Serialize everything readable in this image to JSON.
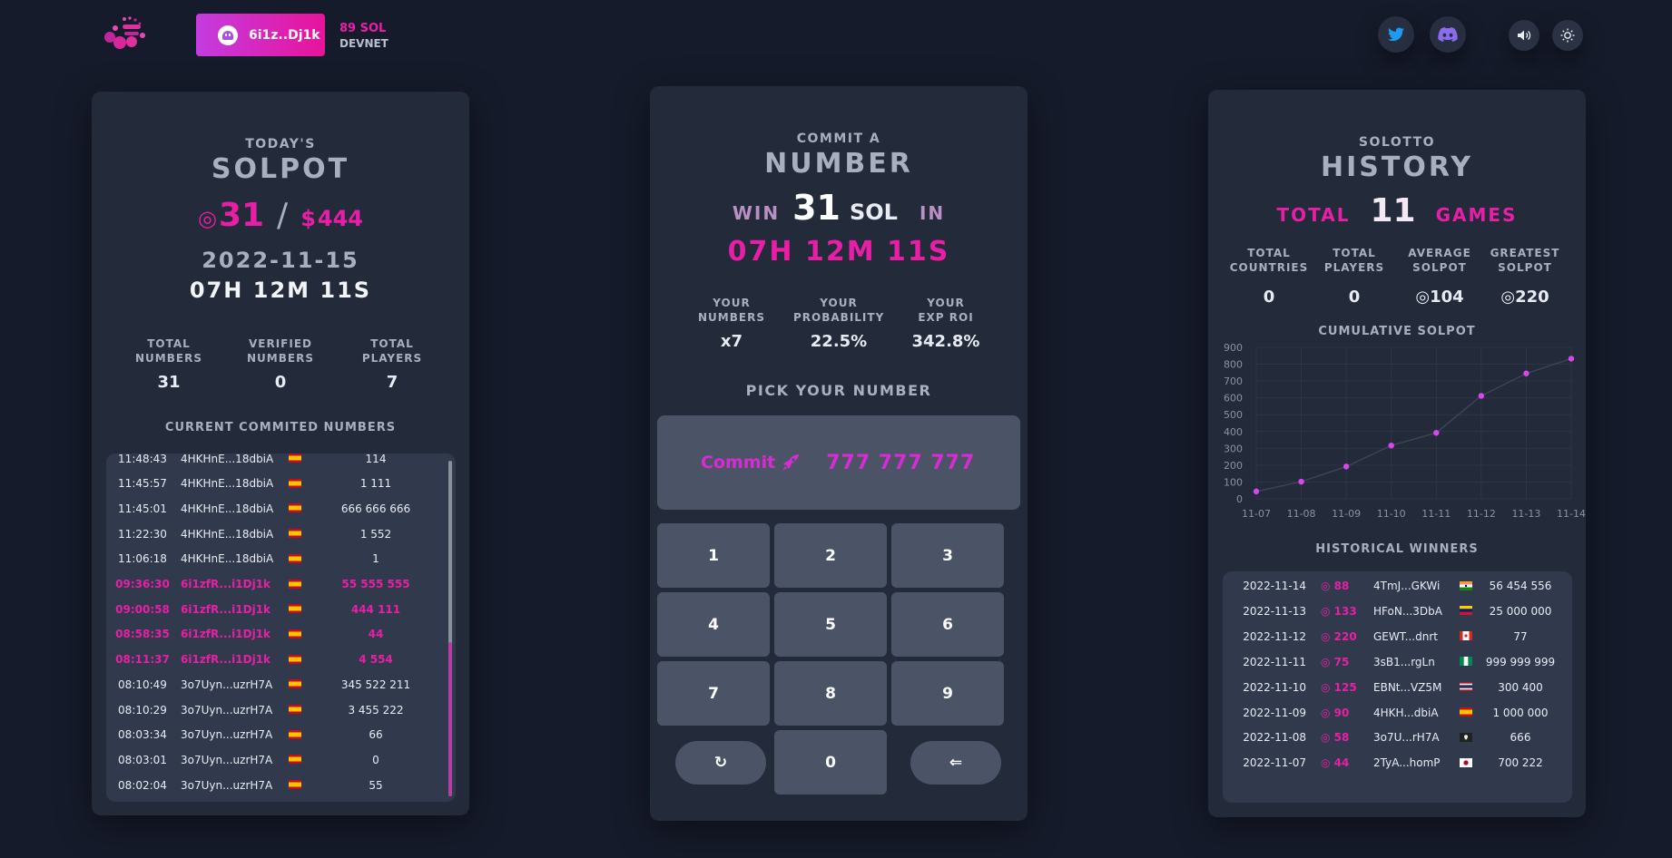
{
  "header": {
    "wallet_address": "6i1z..Dj1k",
    "balance": "89 SOL",
    "network": "DEVNET",
    "icons": [
      "logo-icon",
      "ghost-icon",
      "twitter-icon",
      "discord-icon",
      "sound-icon",
      "theme-icon"
    ]
  },
  "solpot": {
    "eyebrow": "TODAY'S",
    "title": "SOLPOT",
    "sol_symbol": "◎",
    "sol_amount": "31",
    "separator": "/",
    "usd_symbol": "$",
    "usd_amount": "444",
    "date": "2022-11-15",
    "countdown": "07H 12M 11S",
    "stats": [
      {
        "label1": "TOTAL",
        "label2": "NUMBERS",
        "value": "31"
      },
      {
        "label1": "VERIFIED",
        "label2": "NUMBERS",
        "value": "0"
      },
      {
        "label1": "TOTAL",
        "label2": "PLAYERS",
        "value": "7"
      }
    ],
    "list_title": "CURRENT COMMITED NUMBERS",
    "commits": [
      {
        "time": "11:48:43",
        "wallet": "4HKHnE...18dbiA",
        "flag": "es",
        "number": "114",
        "mine": false
      },
      {
        "time": "11:45:57",
        "wallet": "4HKHnE...18dbiA",
        "flag": "es",
        "number": "1 111",
        "mine": false
      },
      {
        "time": "11:45:01",
        "wallet": "4HKHnE...18dbiA",
        "flag": "es",
        "number": "666 666 666",
        "mine": false
      },
      {
        "time": "11:22:30",
        "wallet": "4HKHnE...18dbiA",
        "flag": "es",
        "number": "1 552",
        "mine": false
      },
      {
        "time": "11:06:18",
        "wallet": "4HKHnE...18dbiA",
        "flag": "es",
        "number": "1",
        "mine": false
      },
      {
        "time": "09:36:30",
        "wallet": "6i1zfR...i1Dj1k",
        "flag": "es",
        "number": "55 555 555",
        "mine": true
      },
      {
        "time": "09:00:58",
        "wallet": "6i1zfR...i1Dj1k",
        "flag": "es",
        "number": "444 111",
        "mine": true
      },
      {
        "time": "08:58:35",
        "wallet": "6i1zfR...i1Dj1k",
        "flag": "es",
        "number": "44",
        "mine": true
      },
      {
        "time": "08:11:37",
        "wallet": "6i1zfR...i1Dj1k",
        "flag": "es",
        "number": "4 554",
        "mine": true
      },
      {
        "time": "08:10:49",
        "wallet": "3o7Uyn...uzrH7A",
        "flag": "es",
        "number": "345 522 211",
        "mine": false
      },
      {
        "time": "08:10:29",
        "wallet": "3o7Uyn...uzrH7A",
        "flag": "es",
        "number": "3 455 222",
        "mine": false
      },
      {
        "time": "08:03:34",
        "wallet": "3o7Uyn...uzrH7A",
        "flag": "es",
        "number": "66",
        "mine": false
      },
      {
        "time": "08:03:01",
        "wallet": "3o7Uyn...uzrH7A",
        "flag": "es",
        "number": "0",
        "mine": false
      },
      {
        "time": "08:02:04",
        "wallet": "3o7Uyn...uzrH7A",
        "flag": "es",
        "number": "55",
        "mine": false
      }
    ]
  },
  "commit": {
    "eyebrow": "COMMIT A",
    "title": "NUMBER",
    "win_label": "WIN",
    "win_amount": "31",
    "win_unit": "SOL",
    "in_label": "IN",
    "countdown": "07H 12M 11S",
    "stats": [
      {
        "label1": "YOUR",
        "label2": "NUMBERS",
        "value": "x7"
      },
      {
        "label1": "YOUR",
        "label2": "PROBABILITY",
        "value": "22.5%"
      },
      {
        "label1": "YOUR",
        "label2": "EXP ROI",
        "value": "342.8%"
      }
    ],
    "pick_label": "PICK YOUR NUMBER",
    "commit_button": "Commit",
    "current_number": "777 777 777",
    "keys": [
      "1",
      "2",
      "3",
      "4",
      "5",
      "6",
      "7",
      "8",
      "9",
      "0"
    ],
    "reset_key": "↻",
    "back_key": "⇐"
  },
  "history": {
    "eyebrow": "SOLOTTO",
    "title": "HISTORY",
    "total_label": "TOTAL",
    "total_value": "11",
    "games_label": "GAMES",
    "stats": [
      {
        "label1": "TOTAL",
        "label2": "COUNTRIES",
        "value": "0"
      },
      {
        "label1": "TOTAL",
        "label2": "PLAYERS",
        "value": "0"
      },
      {
        "label1": "AVERAGE",
        "label2": "SOLPOT",
        "value": "◎104"
      },
      {
        "label1": "GREATEST",
        "label2": "SOLPOT",
        "value": "◎220"
      }
    ],
    "chart_title": "CUMULATIVE SOLPOT",
    "winners_title": "HISTORICAL WINNERS",
    "winners": [
      {
        "date": "2022-11-14",
        "pot": "◎ 88",
        "wallet": "4TmJ...GKWi",
        "flag": "in",
        "number": "56 454 556"
      },
      {
        "date": "2022-11-13",
        "pot": "◎ 133",
        "wallet": "HFoN...3DbA",
        "flag": "ve",
        "number": "25 000 000"
      },
      {
        "date": "2022-11-12",
        "pot": "◎ 220",
        "wallet": "GEWT...dnrt",
        "flag": "ca",
        "number": "77"
      },
      {
        "date": "2022-11-11",
        "pot": "◎ 75",
        "wallet": "3sB1...rgLn",
        "flag": "ng",
        "number": "999 999 999"
      },
      {
        "date": "2022-11-10",
        "pot": "◎ 125",
        "wallet": "EBNt...VZ5M",
        "flag": "th",
        "number": "300 400"
      },
      {
        "date": "2022-11-09",
        "pot": "◎ 90",
        "wallet": "4HKH...dbiA",
        "flag": "es",
        "number": "1 000 000"
      },
      {
        "date": "2022-11-08",
        "pot": "◎ 58",
        "wallet": "3o7U...rH7A",
        "flag": "pirate",
        "number": "666"
      },
      {
        "date": "2022-11-07",
        "pot": "◎ 44",
        "wallet": "2TyA...homP",
        "flag": "jp",
        "number": "700 222"
      }
    ]
  },
  "chart_data": {
    "type": "line",
    "title": "CUMULATIVE SOLPOT",
    "categories": [
      "11-07",
      "11-08",
      "11-09",
      "11-10",
      "11-11",
      "11-12",
      "11-13",
      "11-14"
    ],
    "values": [
      44,
      102,
      192,
      317,
      392,
      612,
      745,
      833
    ],
    "ylim": [
      0,
      900
    ],
    "yticks": [
      "0",
      "100",
      "200",
      "300",
      "400",
      "500",
      "600",
      "700",
      "800",
      "900"
    ],
    "grid": true,
    "colors": {
      "point": "#d946ef",
      "line": "#3b4357",
      "grid": "#2e3546"
    }
  },
  "colors": {
    "accent": "#e91ea6",
    "background": "#161b2b",
    "card": "#232a3a",
    "panel": "#313a4d",
    "key": "#4b5366"
  }
}
